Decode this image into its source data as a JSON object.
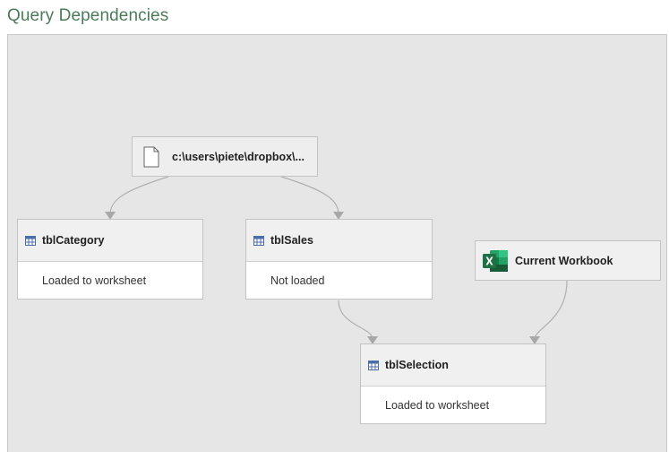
{
  "window": {
    "title": "Query Dependencies"
  },
  "diagram": {
    "source": {
      "label": "c:\\users\\piete\\dropbox\\...",
      "icon": "file-icon"
    },
    "queries": [
      {
        "name": "tblCategory",
        "status": "Loaded to worksheet",
        "icon": "table-icon"
      },
      {
        "name": "tblSales",
        "status": "Not loaded",
        "icon": "table-icon"
      },
      {
        "name": "tblSelection",
        "status": "Loaded to worksheet",
        "icon": "table-icon"
      }
    ],
    "workbook": {
      "label": "Current Workbook",
      "icon": "excel-icon"
    }
  },
  "colors": {
    "title": "#4a7c59",
    "canvas_background": "#e6e6e6",
    "edge": "#b0b0b0",
    "excel_green": "#1e7145"
  }
}
